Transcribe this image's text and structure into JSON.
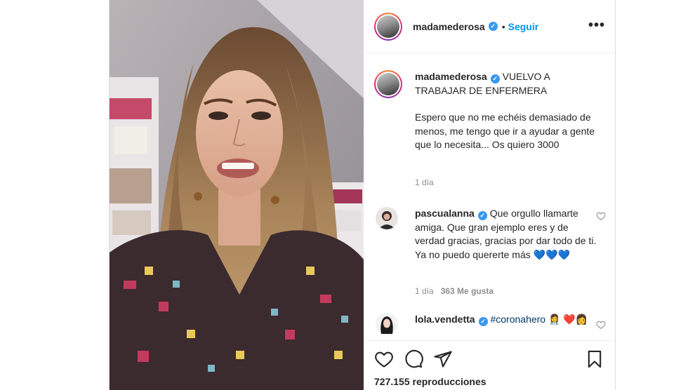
{
  "post": {
    "username": "madamederosa",
    "verified_mark": "✓",
    "separator": "•",
    "follow_label": "Seguir",
    "more_label": "•••"
  },
  "caption": {
    "username": "madamederosa",
    "text_line": " VUELVO A TRABAJAR DE ENFERMERA",
    "body": "Espero que no me echéis demasiado de menos, me tengo que ir a ayudar a gente que lo necesita... Os quiero 3000",
    "time": "1 día"
  },
  "comments": [
    {
      "username": "pascualanna",
      "text": " Que orgullo llamarte amiga. Que gran ejemplo eres y de verdad gracias, gracias por dar todo de ti. Ya no puedo quererte más 💙💙💙",
      "time": "1 día",
      "likes": "363 Me gusta"
    },
    {
      "username": "lola.vendetta",
      "hashtag": "#coronahero",
      "text": " 👩‍⚕️ ❤️👩"
    }
  ],
  "footer": {
    "views": "727.155 reproducciones"
  },
  "icons": [
    "more-options-icon",
    "verified-icon",
    "heart-icon",
    "comment-icon",
    "share-icon",
    "bookmark-icon",
    "small-heart-icon"
  ],
  "colors": {
    "accent": "#0095f6",
    "verified": "#3897f0",
    "text": "#262626",
    "muted": "#8e8e8e"
  }
}
